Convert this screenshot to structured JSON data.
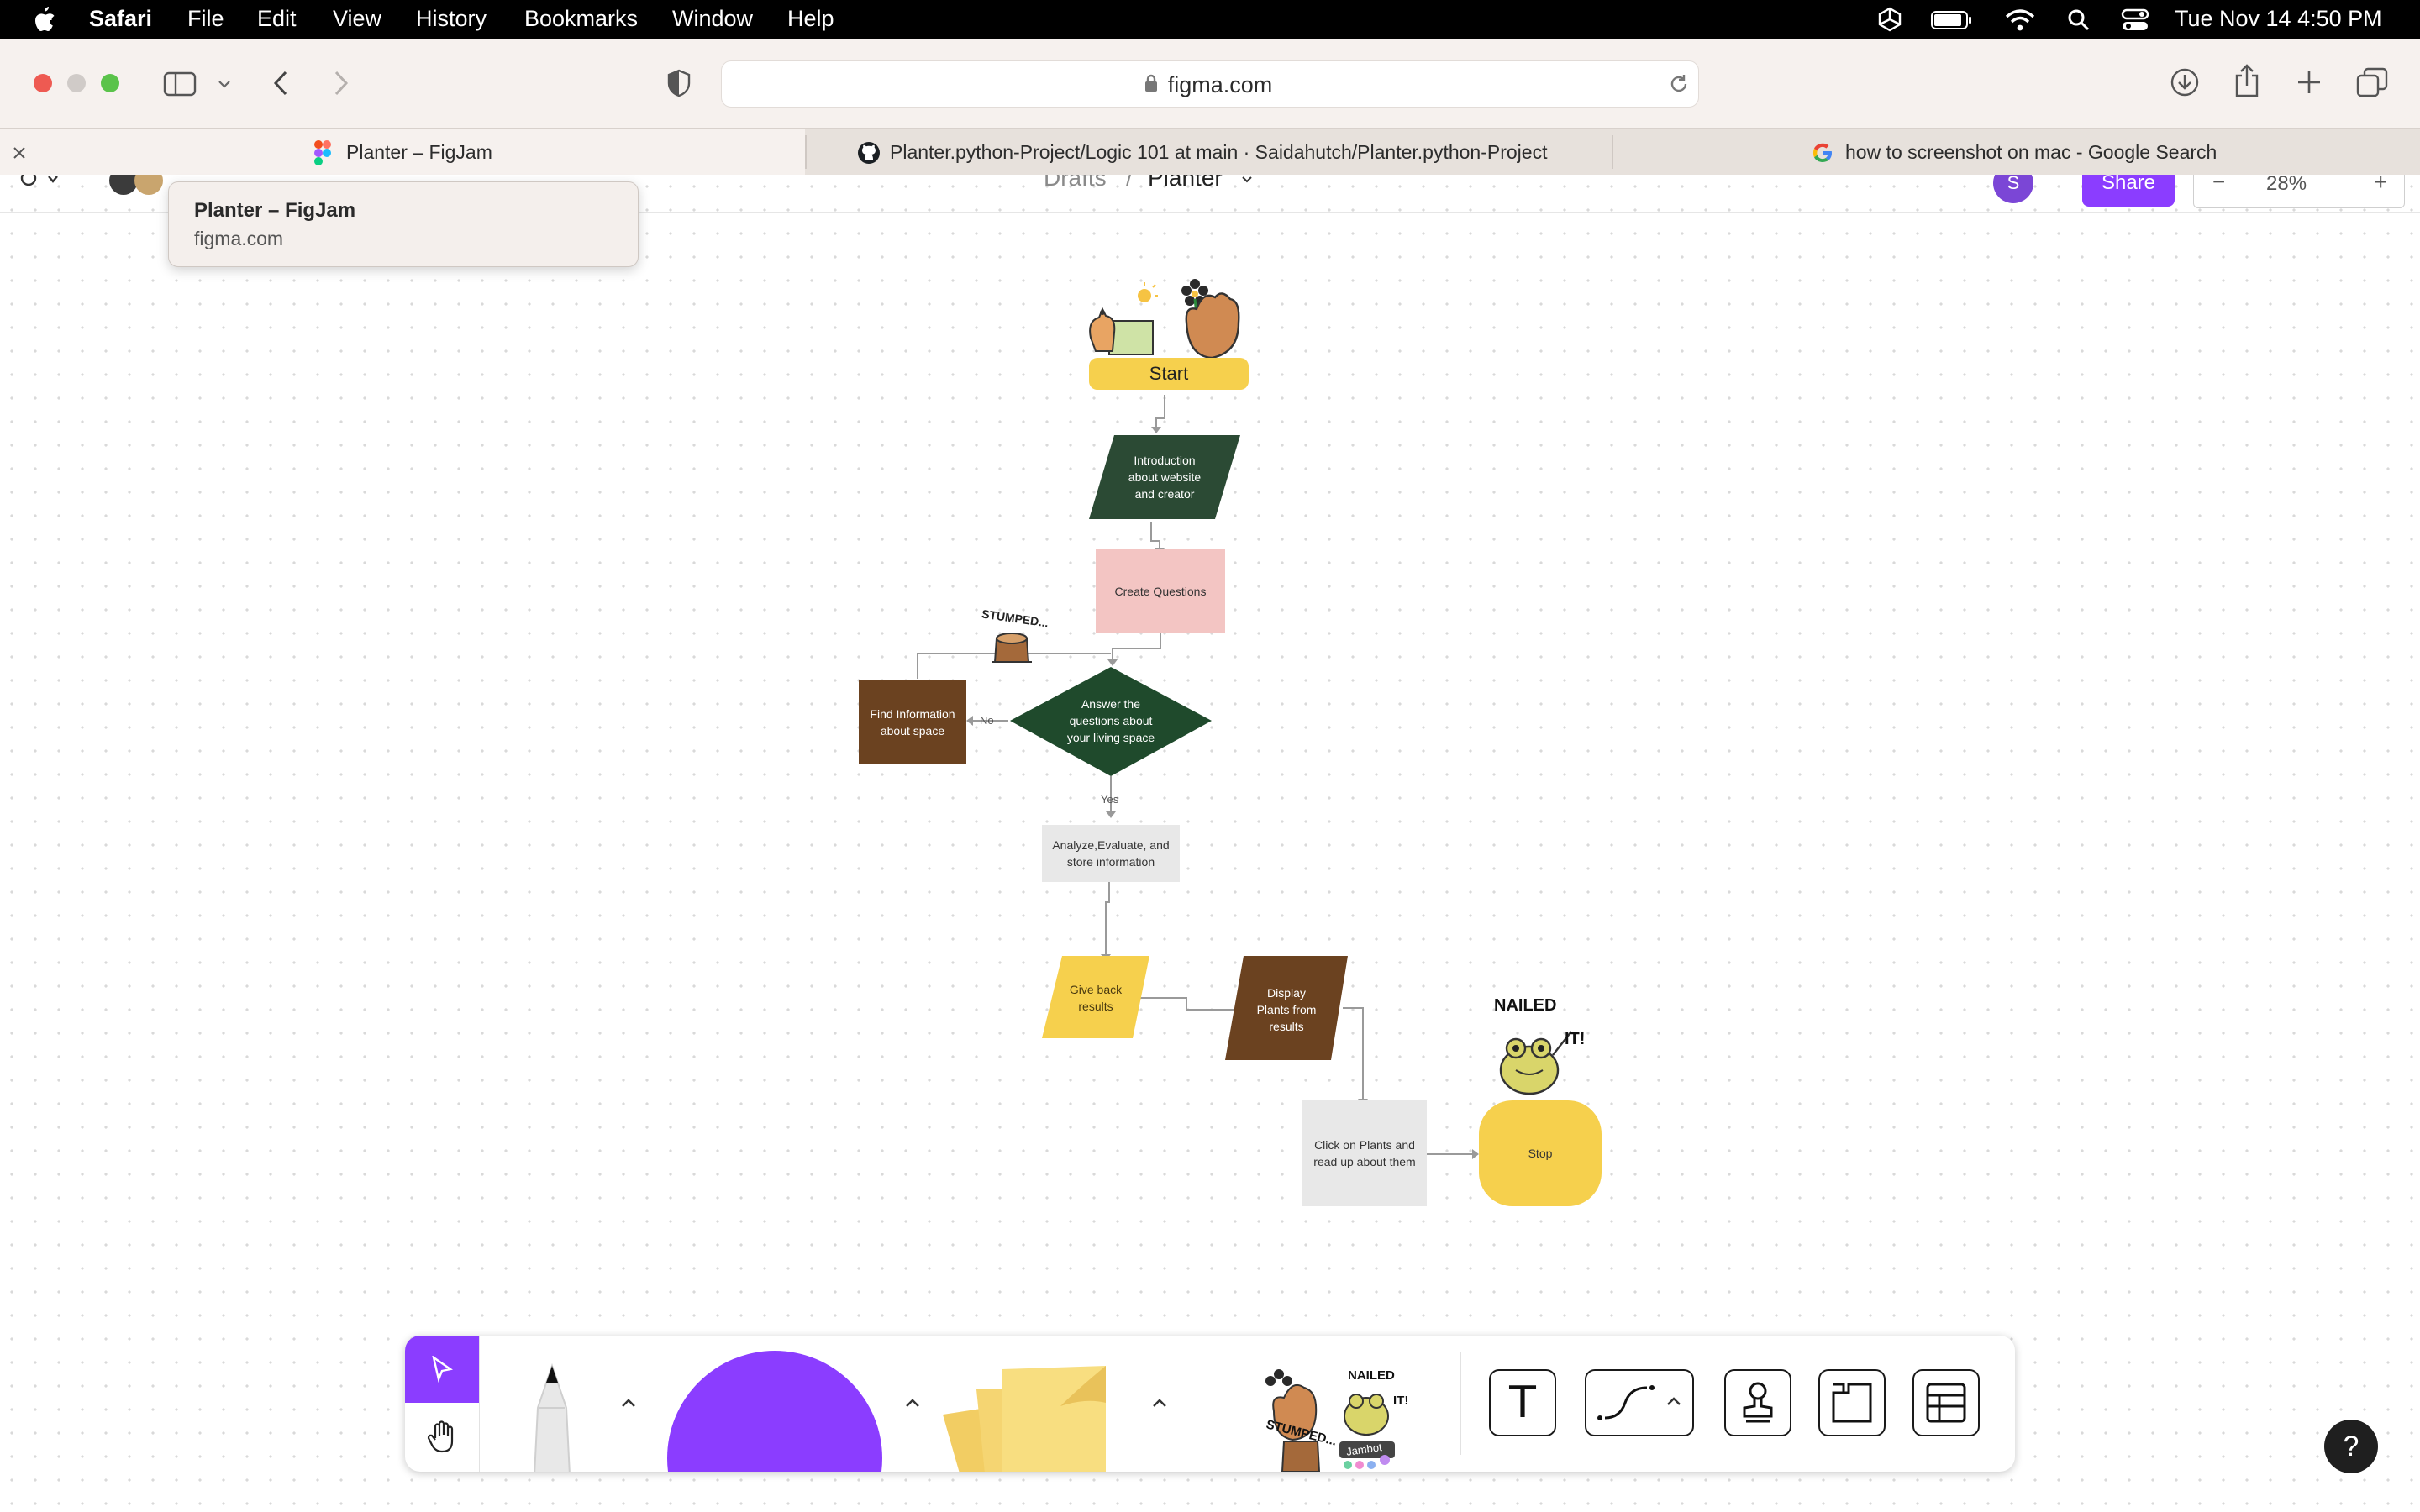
{
  "menubar": {
    "app": "Safari",
    "items": [
      "File",
      "Edit",
      "View",
      "History",
      "Bookmarks",
      "Window",
      "Help"
    ],
    "datetime": "Tue Nov 14  4:50 PM"
  },
  "browser": {
    "url": "figma.com",
    "tabs": [
      {
        "label": "Planter – FigJam",
        "icon": "figma-icon",
        "active": true
      },
      {
        "label": "Planter.python-Project/Logic 101 at main · Saidahutch/Planter.python-Project",
        "icon": "github-icon",
        "active": false
      },
      {
        "label": "how to screenshot on mac - Google Search",
        "icon": "google-icon",
        "active": false
      }
    ]
  },
  "tooltip": {
    "title": "Planter – FigJam",
    "subtitle": "figma.com"
  },
  "figma": {
    "breadcrumb_parent": "Drafts",
    "breadcrumb_sep": "/",
    "file_name": "Planter",
    "share_label": "Share",
    "zoom": "28%",
    "avatar_initial": "S"
  },
  "flow": {
    "start": "Start",
    "intro": [
      "Introduction",
      "about website",
      "and creator"
    ],
    "create": "Create Questions",
    "decision": [
      "Answer the",
      "questions about",
      "your living space"
    ],
    "find": [
      "Find Information",
      "about space"
    ],
    "no_label": "No",
    "yes_label": "Yes",
    "analyze": [
      "Analyze,Evaluate, and",
      "store information"
    ],
    "giveback": [
      "Give back",
      "results"
    ],
    "display": [
      "Display",
      "Plants from",
      "results"
    ],
    "click": [
      "Click on Plants and",
      "read up about them"
    ],
    "stop": "Stop",
    "sticker_stumped": "STUMPED...",
    "sticker_nailed_1": "NAILED",
    "sticker_nailed_2": "IT!"
  },
  "toolbar": {
    "sticker_pack_label": "Jambot",
    "text_tool": "T",
    "help": "?"
  },
  "colors": {
    "accent": "#8b3dff",
    "dark_green": "#2b4a34",
    "brown": "#6b4220",
    "yellow": "#f6d04d",
    "pink": "#f3c5c3",
    "gray_box": "#e8e8e8"
  }
}
